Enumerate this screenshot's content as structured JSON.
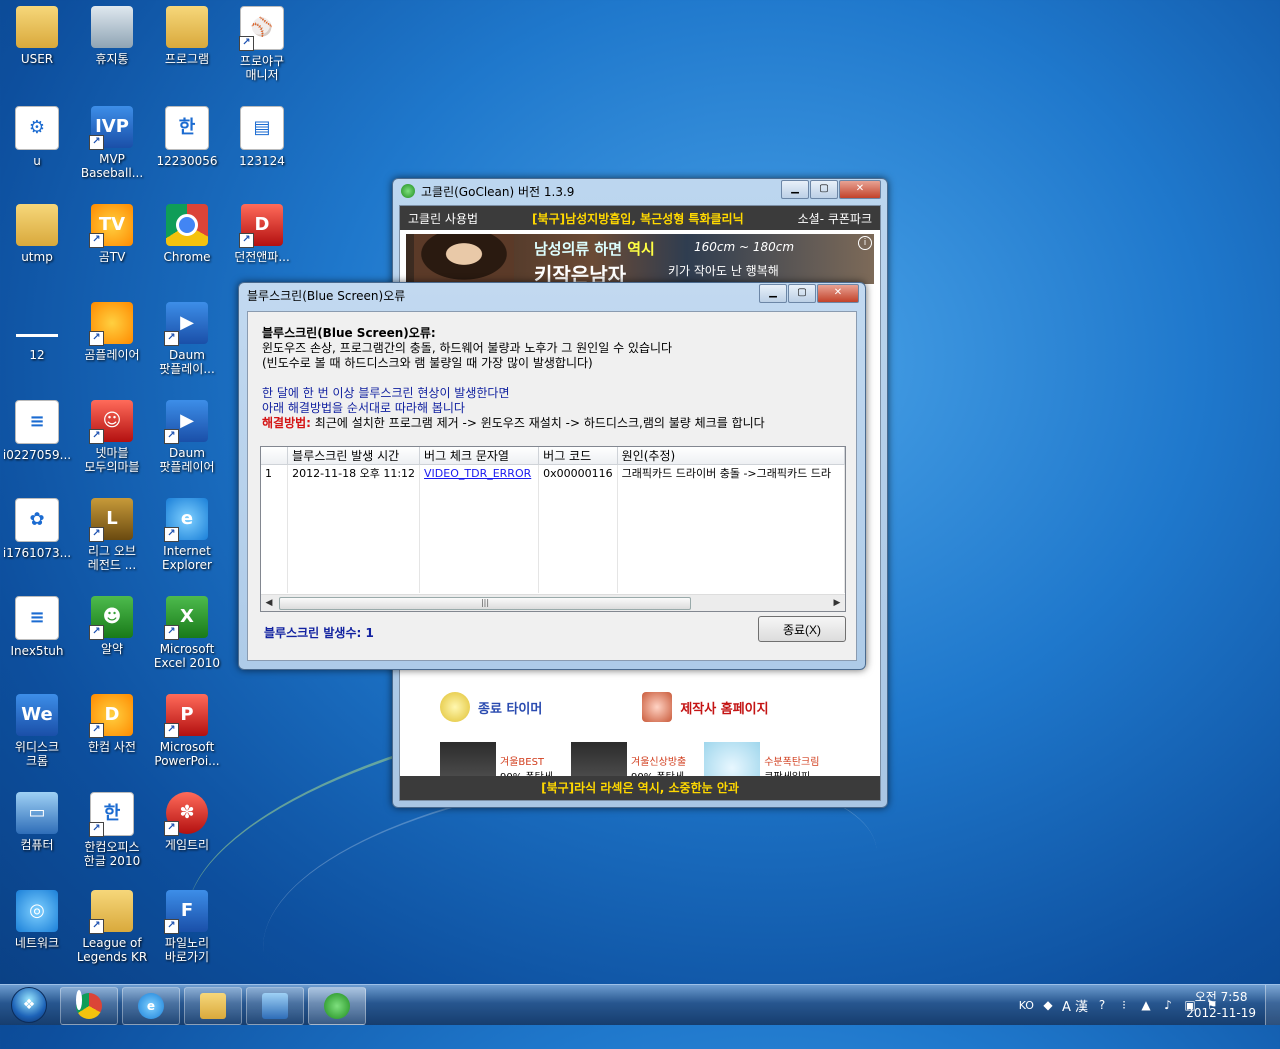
{
  "desktop": {
    "icons": [
      {
        "label": "USER"
      },
      {
        "label": "휴지통"
      },
      {
        "label": "프로그램"
      },
      {
        "label": "프로야구\n매니저"
      },
      {
        "label": "u"
      },
      {
        "label": "MVP\nBaseball..."
      },
      {
        "label": "12230056"
      },
      {
        "label": "123124"
      },
      {
        "label": "utmp"
      },
      {
        "label": "곰TV"
      },
      {
        "label": "Chrome"
      },
      {
        "label": "던전앤파..."
      },
      {
        "label": "12"
      },
      {
        "label": "곰플레이어"
      },
      {
        "label": "Daum\n팟플레이..."
      },
      {
        "label": "i0227059..."
      },
      {
        "label": "넷마블\n모두의마블"
      },
      {
        "label": "Daum\n팟플레이어"
      },
      {
        "label": "i1761073..."
      },
      {
        "label": "리그 오브\n레전드 ..."
      },
      {
        "label": "Internet\nExplorer"
      },
      {
        "label": "Inex5tuh"
      },
      {
        "label": "알약"
      },
      {
        "label": "Microsoft\nExcel 2010"
      },
      {
        "label": "위디스크\n크롬"
      },
      {
        "label": "한컴 사전"
      },
      {
        "label": "Microsoft\nPowerPoi..."
      },
      {
        "label": "컴퓨터"
      },
      {
        "label": "한컴오피스\n한글 2010"
      },
      {
        "label": "게임트리"
      },
      {
        "label": "네트워크"
      },
      {
        "label": "League of\nLegends KR"
      },
      {
        "label": "파일노리\n바로가기"
      }
    ]
  },
  "goclean": {
    "title": "고클린(GoClean) 버전 1.3.9",
    "menu_left": "고클린 사용법",
    "menu_promo": "[북구]남성지방흡입, 복근성형 특화클리닉",
    "menu_right": "소셜- 쿠폰파크",
    "banner_line1a": "남성의류 하면 ",
    "banner_line1b": "역시",
    "banner_line2": "키작은남자",
    "banner_size": "160cm ~ 180cm",
    "banner_tag": "키가 작아도 난 행복해",
    "feature_timer": "종료 타이머",
    "feature_home": "제작사 홈페이지",
    "ads": [
      {
        "t1": "겨울BEST",
        "t2": "90% 폭탄세"
      },
      {
        "t1": "겨울신상방출",
        "t2": "90% 폭탄세"
      },
      {
        "t1": "수분폭탄크림",
        "t2": "쿠팡세일피"
      }
    ],
    "footer": "[북구]라식 라섹은 역시, 소중한눈 안과"
  },
  "dialog": {
    "title": "블루스크린(Blue Screen)오류",
    "heading": "블루스크린(Blue Screen)오류:",
    "desc1": "윈도우즈 손상, 프로그램간의 충돌, 하드웨어 불량과 노후가 그 원인일 수 있습니다",
    "desc2": "(빈도수로 볼 때 하드디스크와 램 불량일 때 가장 많이 발생합니다)",
    "advice1": "한 달에 한 번 이상 블루스크린 현상이 발생한다면",
    "advice2": "아래 해결방법을 순서대로 따라해 봅니다",
    "solution_label": "해결방법:",
    "solution_text": " 최근에 설치한 프로그램 제거 -> 윈도우즈 재설치 -> 하드디스크,램의 불량 체크를 합니다",
    "columns": [
      "",
      "블루스크린 발생 시간",
      "버그 체크 문자열",
      "버그 코드",
      "원인(추정)"
    ],
    "rows": [
      [
        "1",
        "2012-11-18 오후 11:12",
        "VIDEO_TDR_ERROR",
        "0x00000116",
        "그래픽카드 드라이버 충돌 ->그래픽카드 드라"
      ]
    ],
    "count_label": "블루스크린 발생수: 1",
    "close_label": "종료(X)"
  },
  "taskbar": {
    "lang": "KO",
    "ime": "A 漢",
    "time": "오전 7:58",
    "date": "2012-11-19"
  }
}
